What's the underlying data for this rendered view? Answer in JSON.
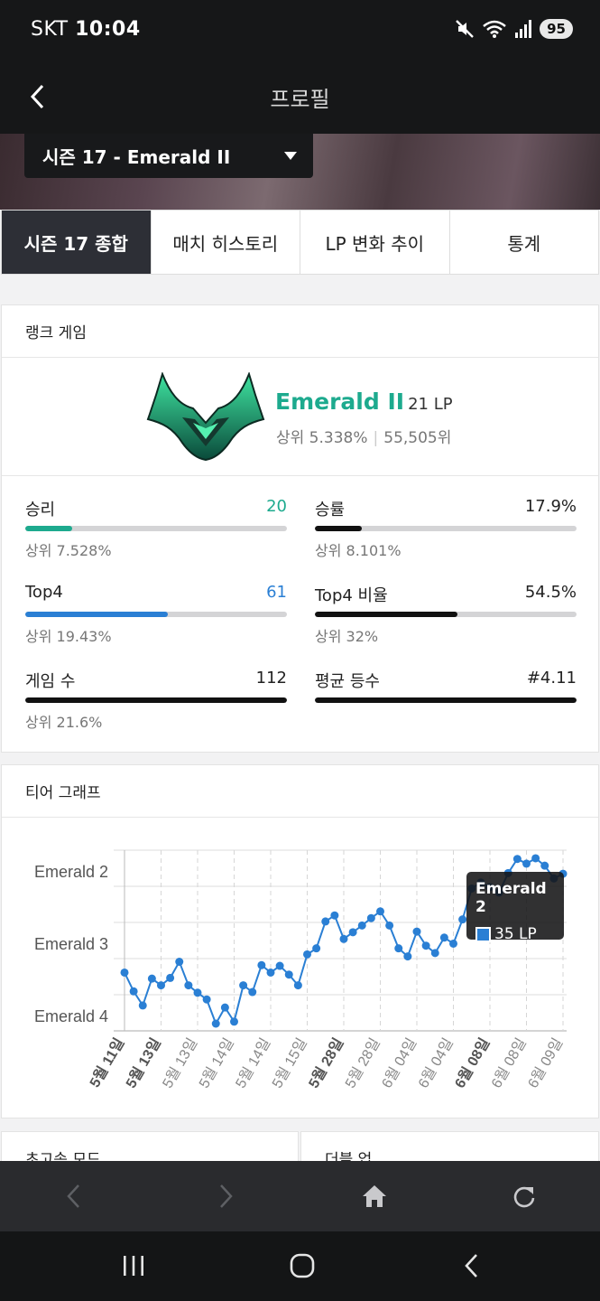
{
  "status_bar": {
    "carrier": "SKT",
    "time": "10:04",
    "battery": "95",
    "wifi_label": "6"
  },
  "app_bar": {
    "title": "프로필"
  },
  "season_selector": {
    "value": "시즌 17 - Emerald II"
  },
  "tabs": [
    {
      "label": "시즌 17 종합",
      "active": true
    },
    {
      "label": "매치 히스토리",
      "active": false
    },
    {
      "label": "LP 변화 추이",
      "active": false
    },
    {
      "label": "통계",
      "active": false
    }
  ],
  "ranked": {
    "header": "랭크 게임",
    "tier": "Emerald II",
    "lp": "21 LP",
    "top_percent": "상위 5.338%",
    "rank": "55,505위",
    "emblem_color": "#1daa8e"
  },
  "stats": [
    {
      "label": "승리",
      "value": "20",
      "sub": "상위 7.528%",
      "fill": 0.18,
      "color": "#1daa8e",
      "value_color": "#1daa8e"
    },
    {
      "label": "승률",
      "value": "17.9%",
      "sub": "상위 8.101%",
      "fill": 0.179,
      "color": "#111111",
      "value_color": "#222222"
    },
    {
      "label": "Top4",
      "value": "61",
      "sub": "상위 19.43%",
      "fill": 0.545,
      "color": "#2a7fd4",
      "value_color": "#2a7fd4"
    },
    {
      "label": "Top4 비율",
      "value": "54.5%",
      "sub": "상위 32%",
      "fill": 0.545,
      "color": "#111111",
      "value_color": "#222222"
    },
    {
      "label": "게임 수",
      "value": "112",
      "sub": "상위 21.6%",
      "fill": 1.0,
      "color": "#111111",
      "value_color": "#222222"
    },
    {
      "label": "평균 등수",
      "value": "#4.11",
      "sub": "",
      "fill": 1.0,
      "color": "#111111",
      "value_color": "#222222"
    }
  ],
  "tier_graph": {
    "header": "티어 그래프",
    "tooltip": {
      "title": "Emerald 2",
      "value": "35 LP",
      "swatch_color": "#2a7fd4"
    }
  },
  "chart_data": {
    "type": "line",
    "title": "",
    "y_ticks": [
      "Emerald 2",
      "Emerald 3",
      "Emerald 4"
    ],
    "ylim": [
      -10,
      120
    ],
    "x_tick_labels": [
      {
        "label": "5월 11일",
        "bold": true
      },
      {
        "label": "5월 13일",
        "bold": true
      },
      {
        "label": "5월 13일",
        "bold": false
      },
      {
        "label": "5월 14일",
        "bold": false
      },
      {
        "label": "5월 14일",
        "bold": false
      },
      {
        "label": "5월 15일",
        "bold": false
      },
      {
        "label": "5월 28일",
        "bold": true
      },
      {
        "label": "5월 28일",
        "bold": false
      },
      {
        "label": "6월 04일",
        "bold": false
      },
      {
        "label": "6월 04일",
        "bold": false
      },
      {
        "label": "6월 08일",
        "bold": true
      },
      {
        "label": "6월 08일",
        "bold": false
      },
      {
        "label": "6월 09일",
        "bold": false
      }
    ],
    "series": [
      {
        "color": "#2a7fd4",
        "values": [
          76,
          48,
          27,
          67,
          57,
          68,
          92,
          57,
          46,
          36,
          0,
          24,
          3,
          57,
          47,
          87,
          76,
          86,
          73,
          57,
          103,
          112,
          152,
          161,
          126,
          136,
          146,
          157,
          167,
          146,
          112,
          100,
          137,
          116,
          105,
          128,
          119,
          155,
          201,
          210,
          203,
          195,
          224,
          245,
          238,
          246,
          235,
          216,
          223
        ]
      }
    ],
    "grid": true,
    "legend": "none"
  },
  "bottom_cards": [
    {
      "title": "초고속 모드"
    },
    {
      "title": "더블 업"
    }
  ]
}
